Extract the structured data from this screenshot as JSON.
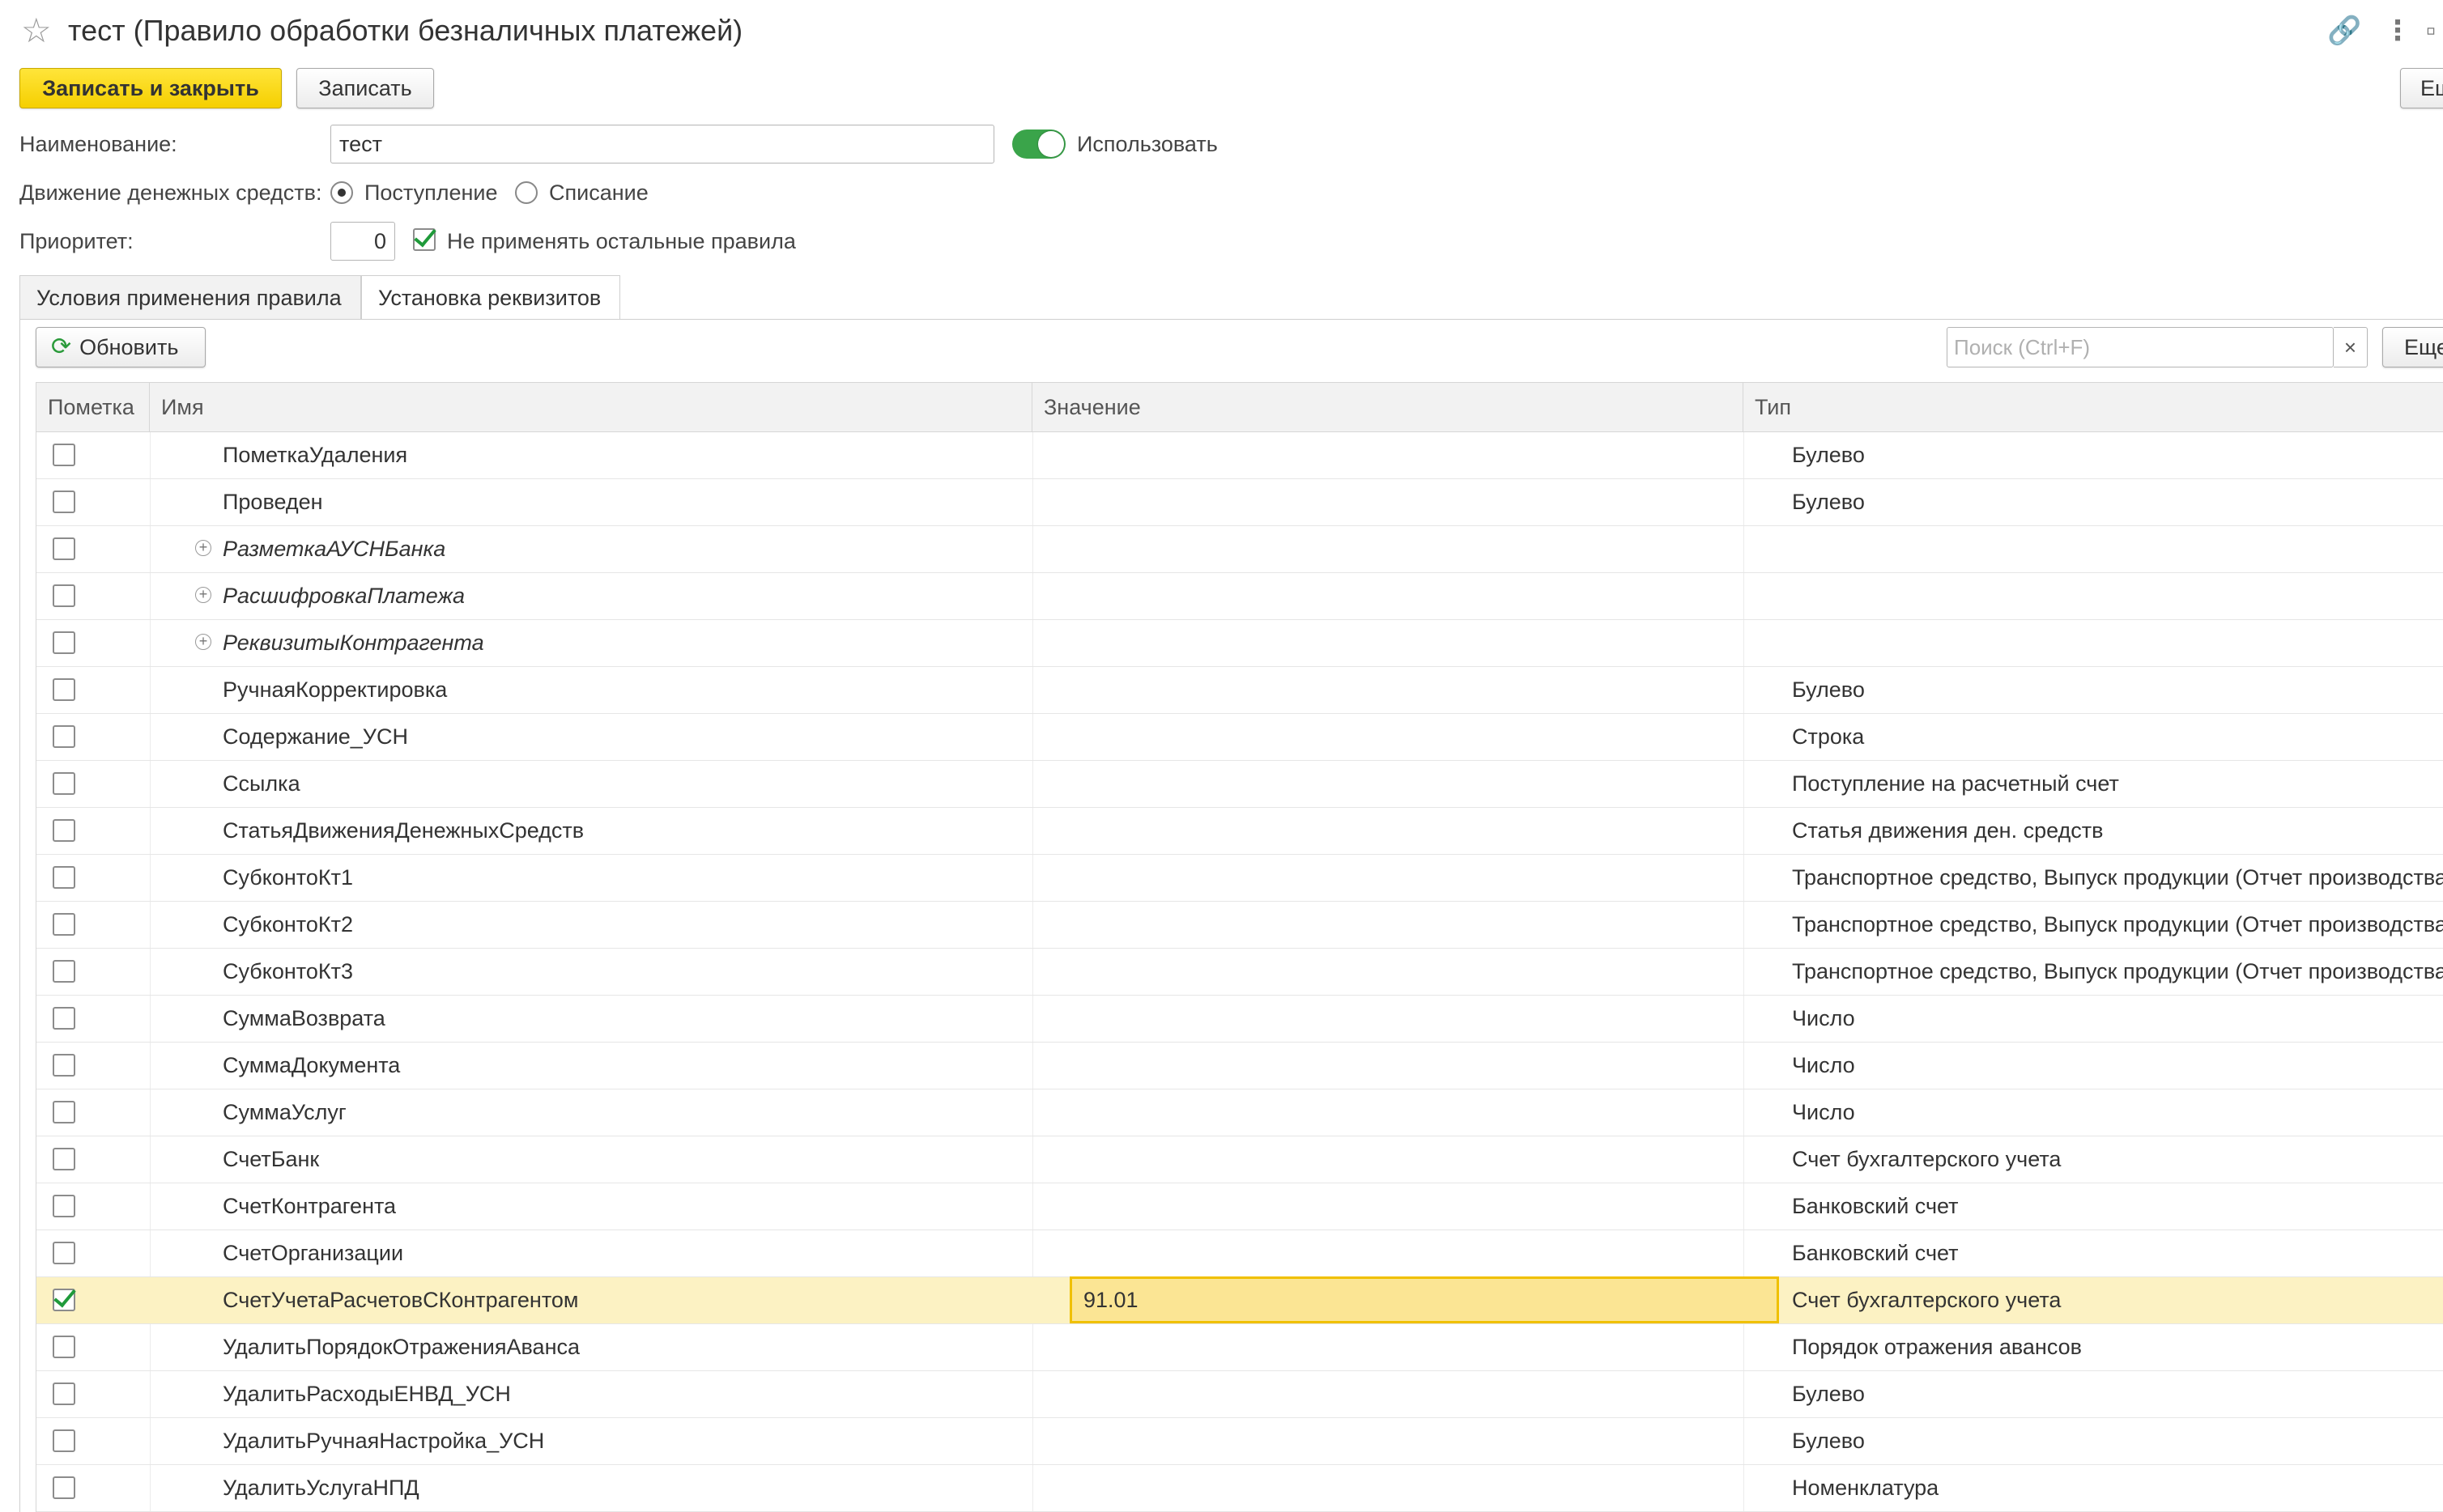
{
  "window": {
    "title": "тест (Правило обработки безналичных платежей)"
  },
  "toolbar": {
    "save_close_label": "Записать и закрыть",
    "save_label": "Записать",
    "more_label": "Ещё"
  },
  "form": {
    "name_label": "Наименование:",
    "name_value": "тест",
    "use_label": "Использовать",
    "use_on": true,
    "cashflow_label": "Движение денежных средств:",
    "cashflow_in_label": "Поступление",
    "cashflow_out_label": "Списание",
    "cashflow_selected": "Поступление",
    "priority_label": "Приоритет:",
    "priority_value": "0",
    "dont_apply_label": "Не применять остальные правила",
    "dont_apply_checked": true
  },
  "tabs": [
    {
      "label": "Условия применения правила",
      "active": false
    },
    {
      "label": "Установка реквизитов",
      "active": true
    }
  ],
  "panel": {
    "refresh_label": "Обновить",
    "search_placeholder": "Поиск (Ctrl+F)",
    "search_clear": "×",
    "more_label": "Еще"
  },
  "table": {
    "columns": [
      "Пометка",
      "Имя",
      "Значение",
      "Тип"
    ],
    "rows": [
      {
        "checked": false,
        "name": "ПометкаУдаления",
        "value": "",
        "type": "Булево",
        "group": false
      },
      {
        "checked": false,
        "name": "Проведен",
        "value": "",
        "type": "Булево",
        "group": false
      },
      {
        "checked": false,
        "name": "РазметкаАУСНБанка",
        "value": "",
        "type": "",
        "group": true
      },
      {
        "checked": false,
        "name": "РасшифровкаПлатежа",
        "value": "",
        "type": "",
        "group": true
      },
      {
        "checked": false,
        "name": "РеквизитыКонтрагента",
        "value": "",
        "type": "",
        "group": true
      },
      {
        "checked": false,
        "name": "РучнаяКорректировка",
        "value": "",
        "type": "Булево",
        "group": false
      },
      {
        "checked": false,
        "name": "Содержание_УСН",
        "value": "",
        "type": "Строка",
        "group": false
      },
      {
        "checked": false,
        "name": "Ссылка",
        "value": "",
        "type": "Поступление на расчетный счет",
        "group": false
      },
      {
        "checked": false,
        "name": "СтатьяДвиженияДенежныхСредств",
        "value": "",
        "type": "Статья движения ден. средств",
        "group": false
      },
      {
        "checked": false,
        "name": "СубконтоКт1",
        "value": "",
        "type": "Транспортное средство, Выпуск продукции (Отчет производства)...",
        "group": false
      },
      {
        "checked": false,
        "name": "СубконтоКт2",
        "value": "",
        "type": "Транспортное средство, Выпуск продукции (Отчет производства)...",
        "group": false
      },
      {
        "checked": false,
        "name": "СубконтоКт3",
        "value": "",
        "type": "Транспортное средство, Выпуск продукции (Отчет производства)...",
        "group": false
      },
      {
        "checked": false,
        "name": "СуммаВозврата",
        "value": "",
        "type": "Число",
        "group": false
      },
      {
        "checked": false,
        "name": "СуммаДокумента",
        "value": "",
        "type": "Число",
        "group": false
      },
      {
        "checked": false,
        "name": "СуммаУслуг",
        "value": "",
        "type": "Число",
        "group": false
      },
      {
        "checked": false,
        "name": "СчетБанк",
        "value": "",
        "type": "Счет бухгалтерского учета",
        "group": false
      },
      {
        "checked": false,
        "name": "СчетКонтрагента",
        "value": "",
        "type": "Банковский счет",
        "group": false
      },
      {
        "checked": false,
        "name": "СчетОрганизации",
        "value": "",
        "type": "Банковский счет",
        "group": false
      },
      {
        "checked": true,
        "name": "СчетУчетаРасчетовСКонтрагентом",
        "value": "91.01",
        "type": "Счет бухгалтерского учета",
        "group": false,
        "selected": true
      },
      {
        "checked": false,
        "name": "УдалитьПорядокОтраженияАванса",
        "value": "",
        "type": "Порядок отражения авансов",
        "group": false
      },
      {
        "checked": false,
        "name": "УдалитьРасходыЕНВД_УСН",
        "value": "",
        "type": "Булево",
        "group": false
      },
      {
        "checked": false,
        "name": "УдалитьРучнаяНастройка_УСН",
        "value": "",
        "type": "Булево",
        "group": false
      },
      {
        "checked": false,
        "name": "УдалитьУслугаНПД",
        "value": "",
        "type": "Номенклатура",
        "group": false
      }
    ]
  },
  "icons": {
    "star": "star-icon",
    "link": "link-icon",
    "menu": "kebab-menu-icon",
    "refresh": "refresh-icon",
    "expand": "plus-circle-icon"
  },
  "colors": {
    "primary_button": "#f5cf00",
    "toggle_on": "#3aa44a",
    "selected_row": "#fcf2c3",
    "active_cell_border": "#f0c000",
    "check_mark": "#1f9a3a"
  }
}
